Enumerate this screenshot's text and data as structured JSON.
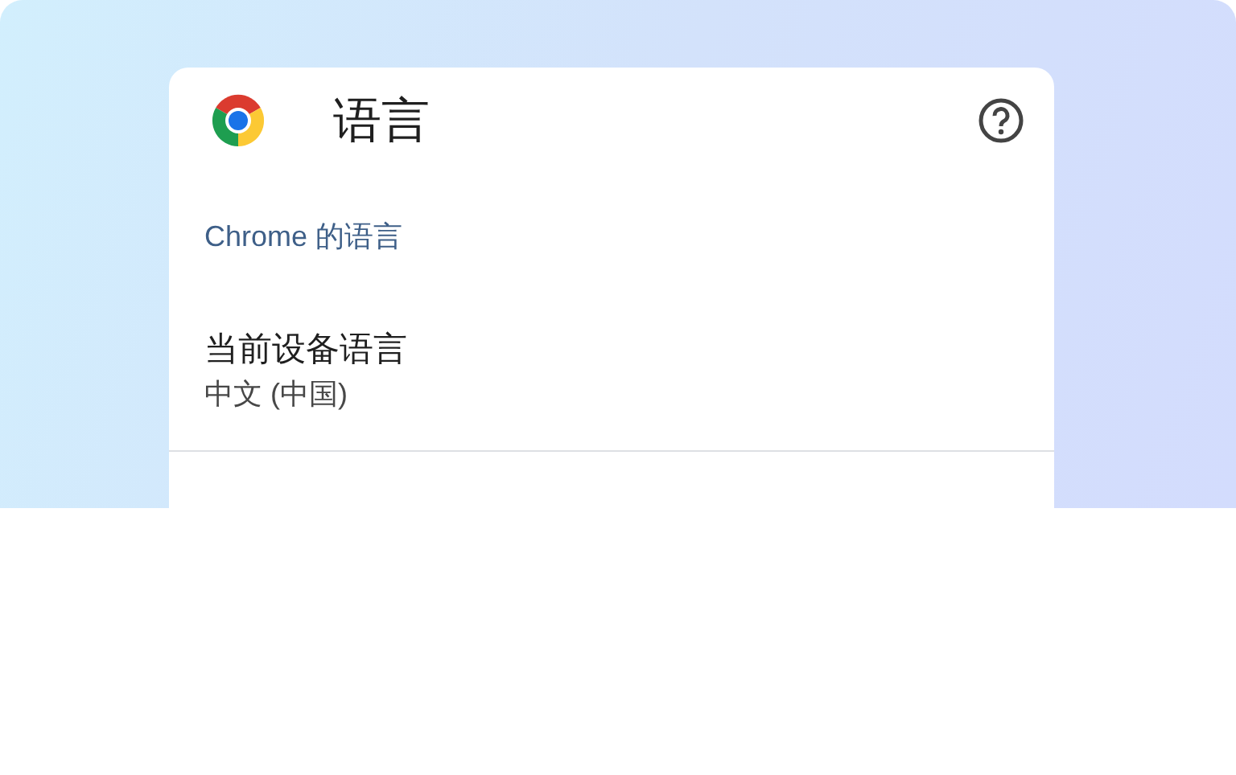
{
  "header": {
    "title": "语言"
  },
  "section": {
    "title": "Chrome 的语言"
  },
  "items": [
    {
      "title": "当前设备语言",
      "subtitle": "中文 (中国)"
    }
  ]
}
